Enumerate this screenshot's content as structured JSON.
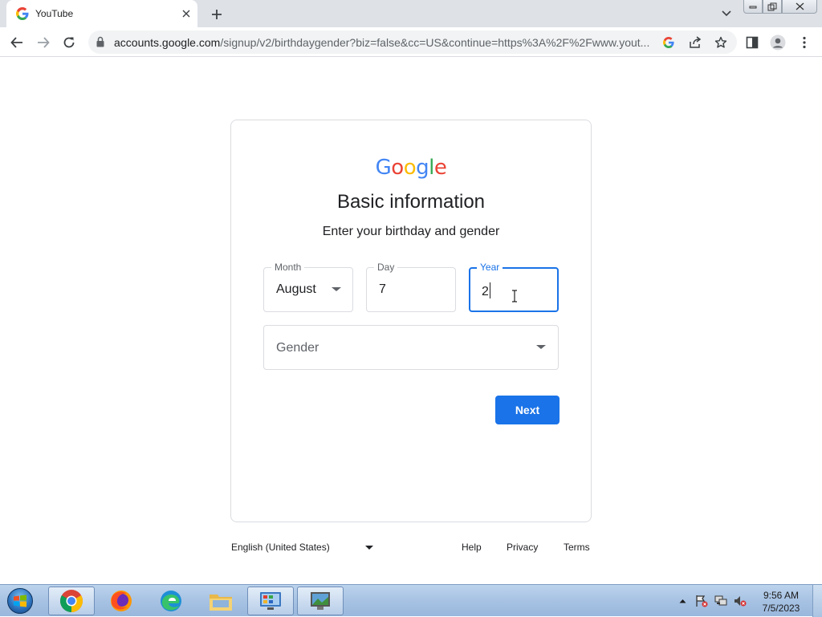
{
  "browser": {
    "tab_title": "YouTube",
    "url_host": "accounts.google.com",
    "url_path": "/signup/v2/birthdaygender?biz=false&cc=US&continue=https%3A%2F%2Fwww.yout..."
  },
  "page": {
    "logo": [
      "G",
      "o",
      "o",
      "g",
      "l",
      "e"
    ],
    "logo_colors": [
      "#4285f4",
      "#ea4335",
      "#fbbc05",
      "#4285f4",
      "#34a853",
      "#ea4335"
    ],
    "heading": "Basic information",
    "subheading": "Enter your birthday and gender",
    "month": {
      "label": "Month",
      "value": "August"
    },
    "day": {
      "label": "Day",
      "value": "7"
    },
    "year": {
      "label": "Year",
      "value": "2"
    },
    "gender": {
      "placeholder": "Gender"
    },
    "next_label": "Next"
  },
  "footer": {
    "language": "English (United States)",
    "links": [
      "Help",
      "Privacy",
      "Terms"
    ]
  },
  "taskbar": {
    "time": "9:56 AM",
    "date": "7/5/2023",
    "apps": [
      "chrome-icon",
      "firefox-icon",
      "edge-icon",
      "file-explorer-icon",
      "control-panel-icon",
      "remote-desktop-icon"
    ]
  },
  "colors": {
    "accent": "#1a73e8",
    "border": "#dadce0"
  }
}
